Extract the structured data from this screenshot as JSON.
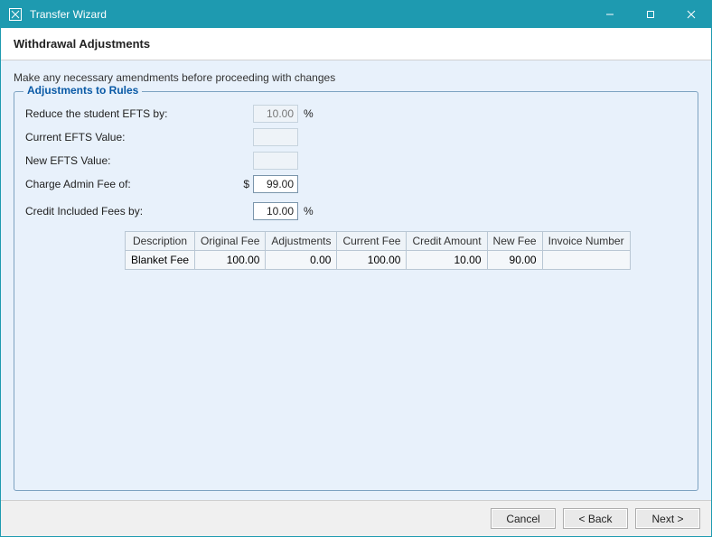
{
  "window": {
    "title": "Transfer Wizard"
  },
  "header": {
    "title": "Withdrawal Adjustments"
  },
  "content": {
    "instruction": "Make any necessary amendments before proceeding with changes",
    "group_title": "Adjustments to Rules",
    "rows": {
      "reduce_efts_label": "Reduce the student EFTS by:",
      "reduce_efts_value": "10.00",
      "reduce_efts_unit": "%",
      "current_efts_label": "Current EFTS Value:",
      "current_efts_value": "",
      "new_efts_label": "New EFTS Value:",
      "new_efts_value": "",
      "admin_fee_label": "Charge Admin Fee of:",
      "admin_fee_currency": "$",
      "admin_fee_value": "99.00",
      "credit_fees_label": "Credit Included Fees by:",
      "credit_fees_value": "10.00",
      "credit_fees_unit": "%"
    },
    "table": {
      "headers": {
        "description": "Description",
        "original_fee": "Original Fee",
        "adjustments": "Adjustments",
        "current_fee": "Current Fee",
        "credit_amount": "Credit Amount",
        "new_fee": "New Fee",
        "invoice_number": "Invoice Number"
      },
      "rows": [
        {
          "description": "Blanket Fee",
          "original_fee": "100.00",
          "adjustments": "0.00",
          "current_fee": "100.00",
          "credit_amount": "10.00",
          "new_fee": "90.00",
          "invoice_number": ""
        }
      ]
    }
  },
  "footer": {
    "cancel": "Cancel",
    "back": "< Back",
    "next": "Next >"
  }
}
